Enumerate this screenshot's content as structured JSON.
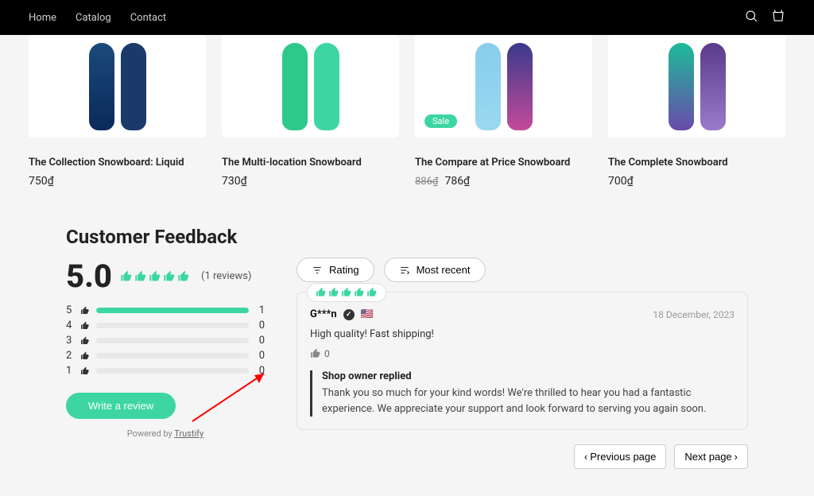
{
  "nav": {
    "home": "Home",
    "catalog": "Catalog",
    "contact": "Contact"
  },
  "products": [
    {
      "title": "The Collection Snowboard: Liquid",
      "price": "750₫",
      "sale": false
    },
    {
      "title": "The Multi-location Snowboard",
      "price": "730₫",
      "sale": false
    },
    {
      "title": "The Compare at Price Snowboard",
      "old_price": "886₫",
      "price": "786₫",
      "sale": true,
      "sale_label": "Sale"
    },
    {
      "title": "The Complete Snowboard",
      "price": "700₫",
      "sale": false
    }
  ],
  "feedback": {
    "title": "Customer Feedback",
    "rating": "5.0",
    "review_count": "(1 reviews)",
    "bars": [
      {
        "star": "5",
        "fill": 100,
        "count": "1"
      },
      {
        "star": "4",
        "fill": 0,
        "count": "0"
      },
      {
        "star": "3",
        "fill": 0,
        "count": "0"
      },
      {
        "star": "2",
        "fill": 0,
        "count": "0"
      },
      {
        "star": "1",
        "fill": 0,
        "count": "0"
      }
    ],
    "write_btn": "Write a review",
    "powered_prefix": "Powered by ",
    "powered_link": "Trustify"
  },
  "filters": {
    "rating": "Rating",
    "recent": "Most recent"
  },
  "review": {
    "name": "G***n",
    "flag": "🇺🇸",
    "date": "18 December, 2023",
    "text": "High quality! Fast shipping!",
    "helpful_count": "0",
    "reply_title": "Shop owner replied",
    "reply_text": "Thank you so much for your kind words! We're thrilled to hear you had a fantastic experience. We appreciate your support and look forward to serving you again soon."
  },
  "pagination": {
    "prev": "Previous page",
    "next": "Next page"
  }
}
